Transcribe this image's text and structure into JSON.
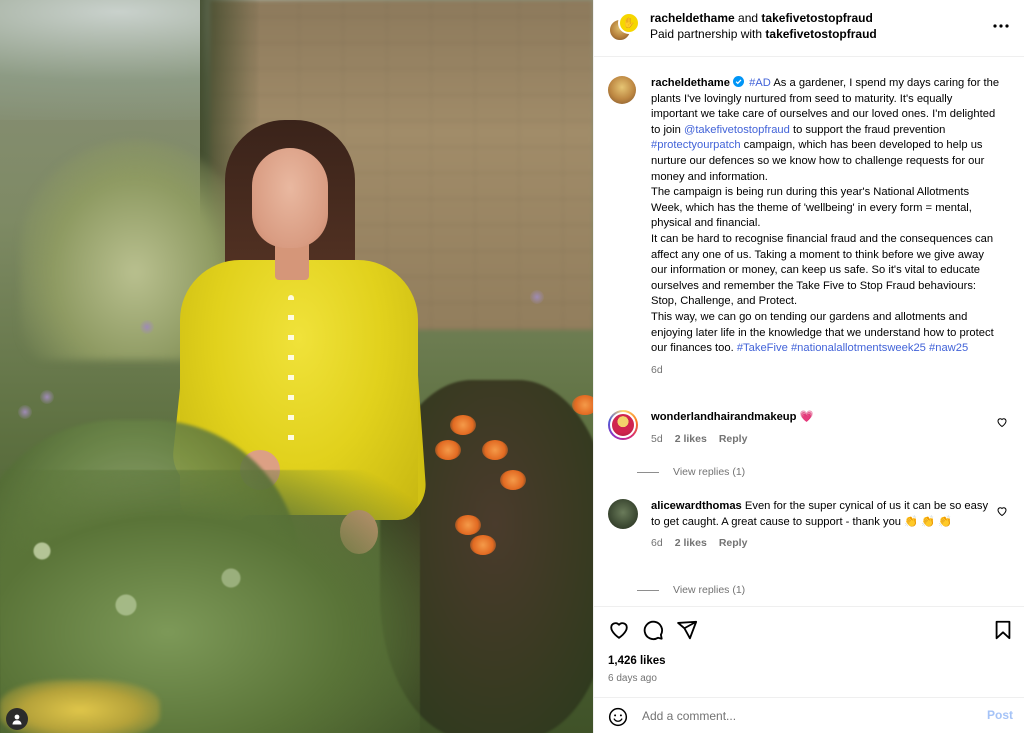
{
  "header": {
    "user1": "racheldethame",
    "joiner": "and",
    "user2": "takefivetostopfraud",
    "partnership_prefix": "Paid partnership with",
    "partner": "takefivetostopfraud",
    "more_icon": "more-horizontal-icon"
  },
  "caption": {
    "username": "racheldethame",
    "ad_tag": "#AD",
    "text_1": "As a gardener, I spend my days caring for the plants I've lovingly nurtured from seed to maturity. It's equally important we take care of ourselves and our loved ones. I'm delighted to join",
    "mention": "@takefivetostopfraud",
    "text_2": "to support the fraud prevention",
    "hashtag_patch": "#protectyourpatch",
    "text_3": "campaign, which has been developed to help us nurture our defences so we know how to challenge requests for our money and information.",
    "para_2": "The campaign is being run during this year's National Allotments Week, which has the theme of 'wellbeing' in every form = mental, physical and financial.",
    "para_3": "It can be hard to recognise financial fraud and the consequences can affect any one of us. Taking a moment to think before we give away our information or money, can keep us safe. So it's vital to educate ourselves and remember the Take Five to Stop Fraud behaviours: Stop, Challenge, and Protect.",
    "para_4": "This way, we can go on tending our gardens and allotments and enjoying later life in the knowledge that we understand how to protect our finances too.",
    "tag_takefive": "#TakeFive",
    "tag_week": "#nationalallotmentsweek25",
    "tag_naw": "#naw25",
    "age": "6d"
  },
  "comments": [
    {
      "username": "wonderlandhairandmakeup",
      "text": "💗",
      "age": "5d",
      "likes": "2 likes",
      "reply": "Reply",
      "view_replies": "View replies (1)"
    },
    {
      "username": "alicewardthomas",
      "text": "Even for the super cynical of us it can be so easy to get caught. A great cause to support - thank you 👏 👏 👏",
      "age": "6d",
      "likes": "2 likes",
      "reply": "Reply",
      "view_replies": "View replies (1)"
    }
  ],
  "actions": {
    "likes": "1,426 likes",
    "date": "6 days ago"
  },
  "composer": {
    "placeholder": "Add a comment...",
    "post_label": "Post"
  },
  "colors": {
    "link": "#4263d8",
    "muted": "#737373",
    "post_disabled": "#a5c3f7",
    "verified": "#0095f6"
  }
}
